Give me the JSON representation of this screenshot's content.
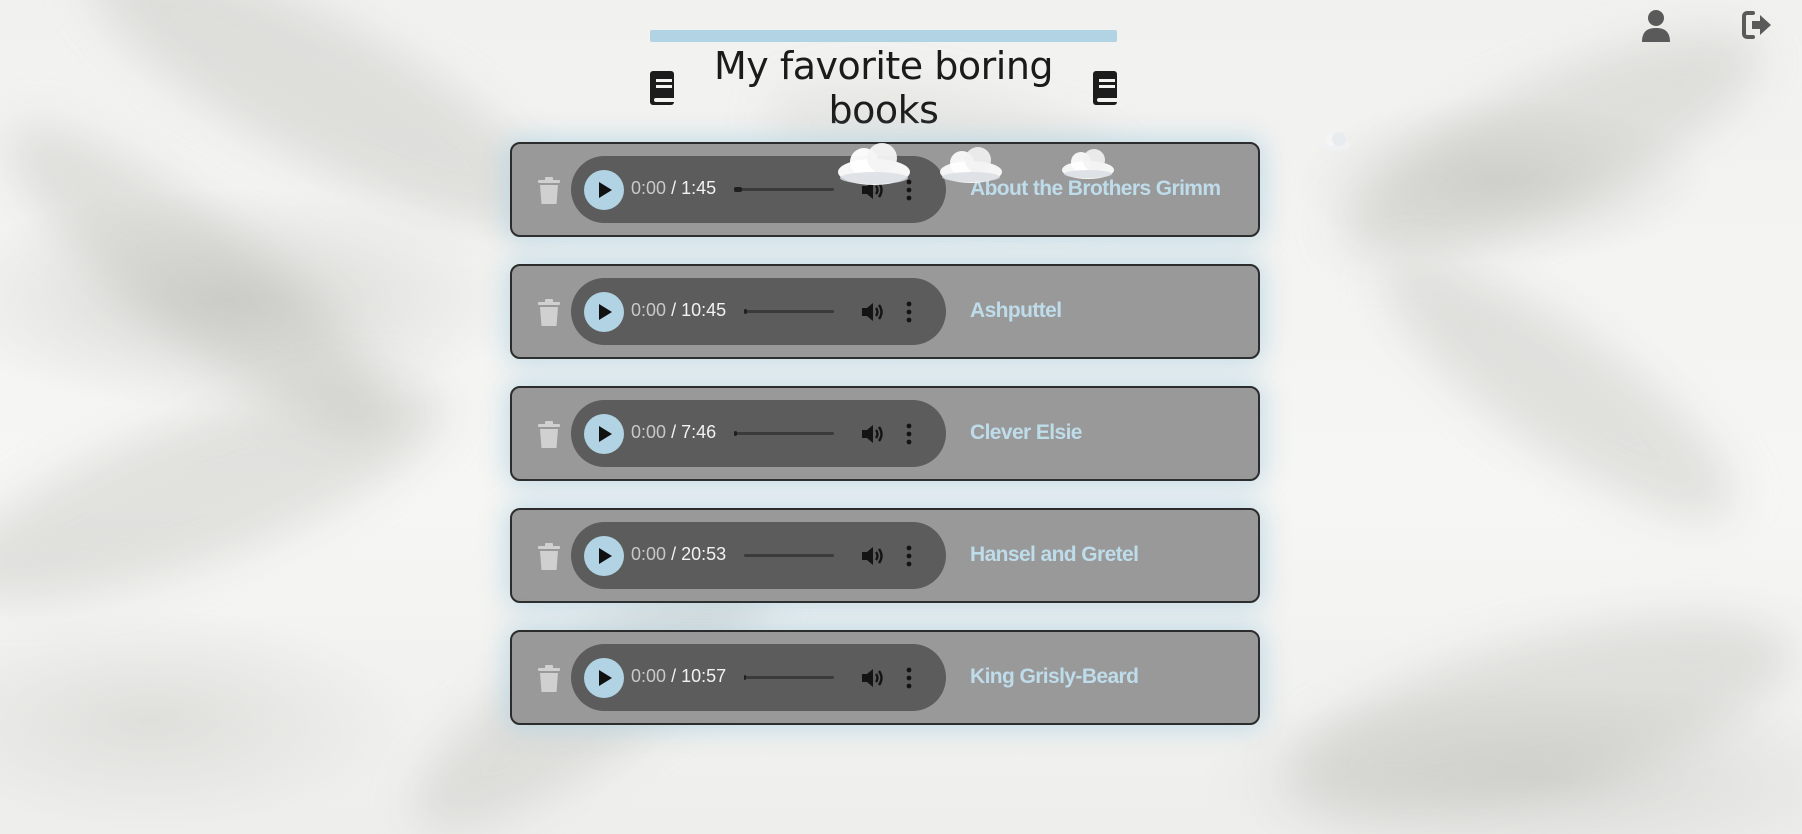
{
  "header": {
    "title": "My favorite boring books",
    "icons": [
      "book-icon",
      "book-icon"
    ]
  },
  "top_nav": {
    "icons": [
      "user-icon",
      "sign-out-icon"
    ]
  },
  "books": [
    {
      "title": "About the Brothers Grimm",
      "current": "0:00",
      "duration": "/ 1:45"
    },
    {
      "title": "Ashputtel",
      "current": "0:00",
      "duration": "/ 10:45"
    },
    {
      "title": "Clever Elsie",
      "current": "0:00",
      "duration": "/ 7:46"
    },
    {
      "title": "Hansel and Gretel",
      "current": "0:00",
      "duration": "/ 20:53"
    },
    {
      "title": "King Grisly-Beard",
      "current": "0:00",
      "duration": "/ 10:57"
    }
  ],
  "row_icons": [
    "trash-icon",
    "play-icon",
    "volume-icon",
    "more-vertical-icon"
  ],
  "colors": {
    "accent": "#b2d3e3",
    "row_bg": "#999999",
    "player_bg": "#5c5c5c",
    "title_text": "#bfdcea"
  }
}
